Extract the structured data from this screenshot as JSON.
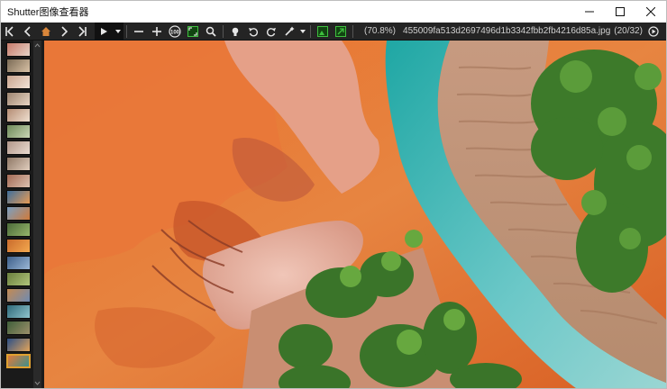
{
  "window": {
    "title": "Shutter图像查看器",
    "controls": {
      "minimize": "minimize",
      "maximize": "maximize",
      "close": "close"
    }
  },
  "toolbar": {
    "buttons": [
      "first-image",
      "previous-image",
      "home",
      "next-image",
      "last-image",
      "play-slideshow",
      "slideshow-options",
      "zoom-out",
      "zoom-in",
      "actual-size-100",
      "fit-window",
      "search",
      "light-bulb",
      "rotate-left",
      "rotate-right",
      "edit-tools",
      "edit-tools-dropdown",
      "open-green",
      "external-edit"
    ],
    "actual_size_label": "100",
    "zoom_percent": "(70.8%)",
    "filename": "455009fa513d2697496d1b3342fbb2fb4216d85a.jpg",
    "position_counter": "(20/32)",
    "right_button": "next-play"
  },
  "thumbnails": {
    "count": 20,
    "active_index": 19
  },
  "colors": {
    "accent_active_thumb": "#e0a030",
    "toolbar_bg": "#242424",
    "window_bg": "#1c1c1c",
    "icon": "#e6e6e6",
    "home_icon": "#d9863a",
    "green_icon": "#3fbf3f"
  }
}
